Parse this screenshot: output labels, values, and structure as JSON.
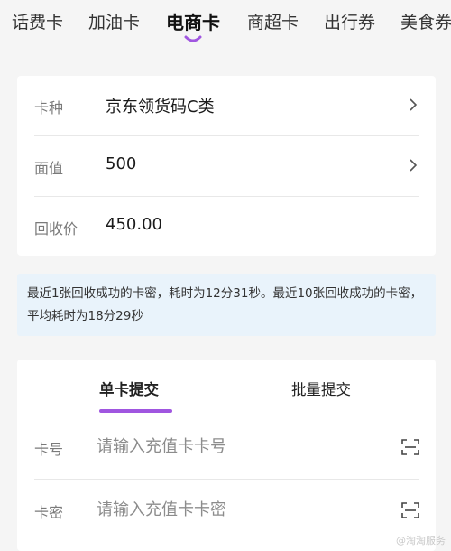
{
  "tabs": [
    {
      "label": "话费卡"
    },
    {
      "label": "加油卡"
    },
    {
      "label": "电商卡"
    },
    {
      "label": "商超卡"
    },
    {
      "label": "出行券"
    },
    {
      "label": "美食券"
    }
  ],
  "active_tab_index": 2,
  "card_info": {
    "type_label": "卡种",
    "type_value": "京东领货码C类",
    "face_label": "面值",
    "face_value": "500",
    "recycle_label": "回收价",
    "recycle_value": "450.00"
  },
  "notice": {
    "text": "最近1张回收成功的卡密，耗时为12分31秒。最近10张回收成功的卡密，平均耗时为18分29秒"
  },
  "submit": {
    "tab_single": "单卡提交",
    "tab_batch": "批量提交",
    "card_no_label": "卡号",
    "card_no_placeholder": "请输入充值卡卡号",
    "card_pwd_label": "卡密",
    "card_pwd_placeholder": "请输入充值卡卡密"
  },
  "icons": {
    "chevron": "chevron-right-icon",
    "scan": "scan-icon"
  },
  "colors": {
    "accent": "#a056e0",
    "notice_bg": "#e9f3fb"
  },
  "watermark": "@淘淘服务"
}
